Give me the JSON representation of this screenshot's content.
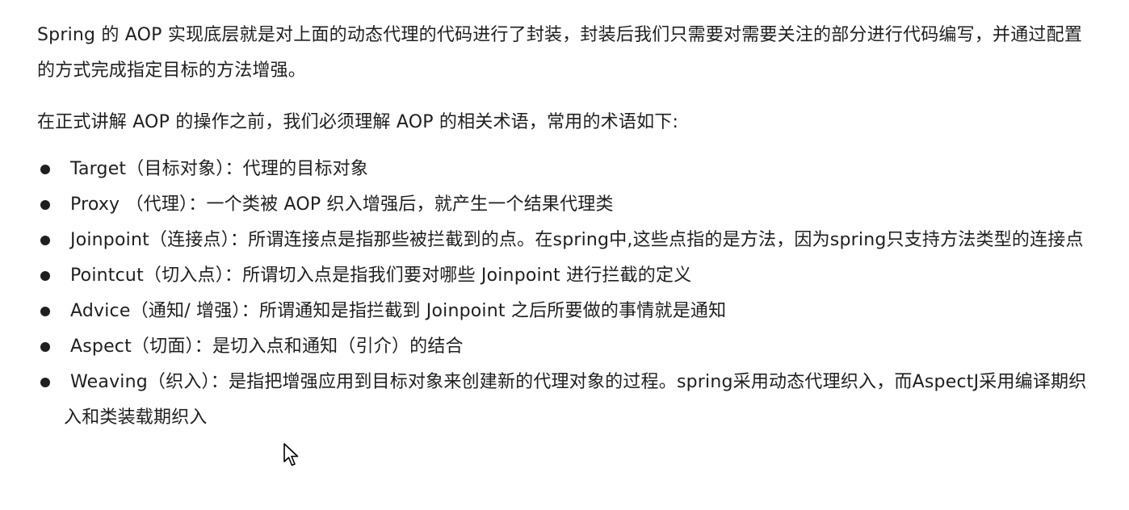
{
  "intro": {
    "paragraph1": "Spring 的 AOP 实现底层就是对上面的动态代理的代码进行了封装，封装后我们只需要对需要关注的部分进行代码编写，并通过配置的方式完成指定目标的方法增强。",
    "paragraph2": "在正式讲解 AOP 的操作之前，我们必须理解 AOP 的相关术语，常用的术语如下:"
  },
  "terms": [
    {
      "name": "Target（目标对象）",
      "sep": "：",
      "desc": "代理的目标对象"
    },
    {
      "name": "Proxy （代理）",
      "sep": "：",
      "desc": "一个类被 AOP 织入增强后，就产生一个结果代理类"
    },
    {
      "name": "Joinpoint（连接点）",
      "sep": "：",
      "desc": "所谓连接点是指那些被拦截到的点。在spring中,这些点指的是方法，因为spring只支持方法类型的连接点"
    },
    {
      "name": "Pointcut（切入点）",
      "sep": "：",
      "desc": "所谓切入点是指我们要对哪些 Joinpoint 进行拦截的定义"
    },
    {
      "name": "Advice（通知/ 增强）",
      "sep": "：",
      "desc": "所谓通知是指拦截到 Joinpoint 之后所要做的事情就是通知"
    },
    {
      "name": "Aspect（切面）",
      "sep": "：",
      "desc": "是切入点和通知（引介）的结合"
    },
    {
      "name": "Weaving（织入）",
      "sep": "：",
      "desc": "是指把增强应用到目标对象来创建新的代理对象的过程。spring采用动态代理织入，而AspectJ采用编译期织入和类装载期织入"
    }
  ]
}
